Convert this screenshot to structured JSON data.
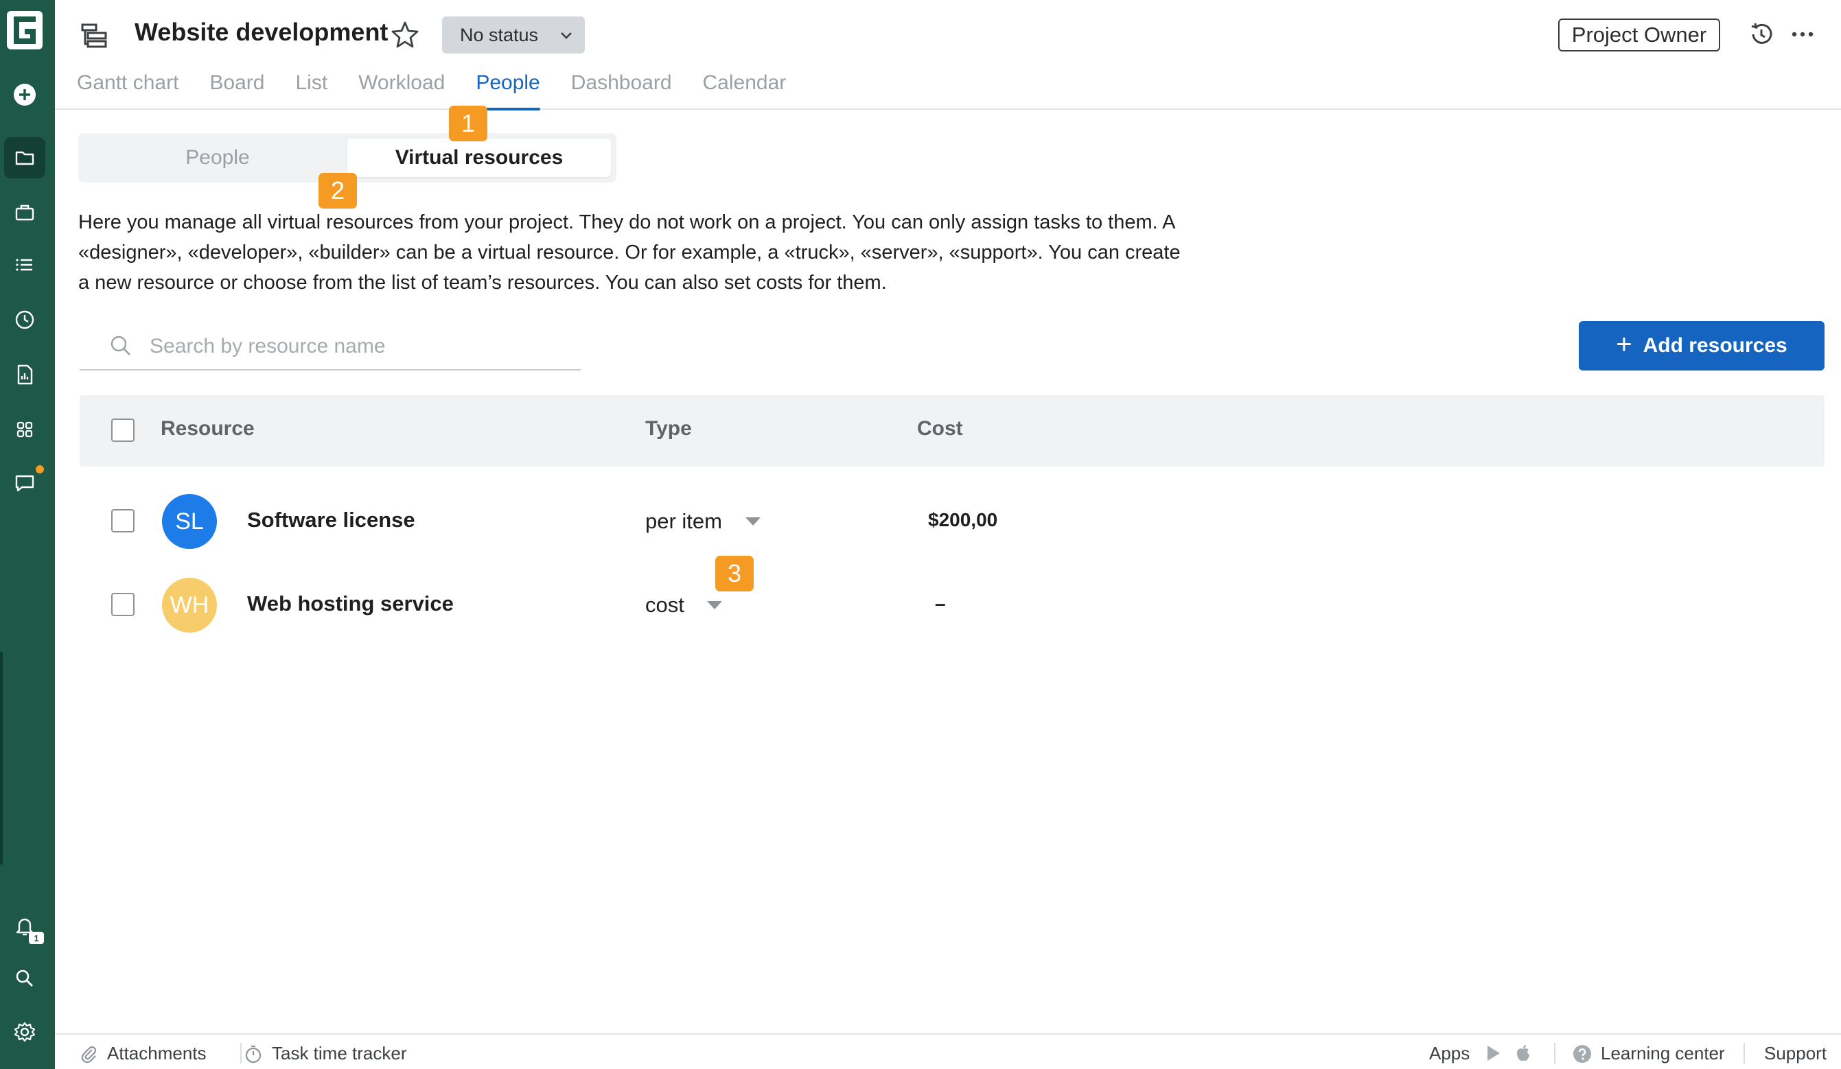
{
  "project": {
    "title": "Website development",
    "status": "No status",
    "role": "Project Owner"
  },
  "tabs": [
    "Gantt chart",
    "Board",
    "List",
    "Workload",
    "People",
    "Dashboard",
    "Calendar"
  ],
  "active_tab": "People",
  "segment": {
    "people_label": "People",
    "virtual_label": "Virtual resources",
    "selected": "Virtual resources"
  },
  "markers": [
    "1",
    "2",
    "3"
  ],
  "description": "Here you manage all virtual resources from your project. They do not work on a project. You can only assign tasks to them. A «designer», «developer», «builder» can be a virtual resource. Or for example, a «truck», «server», «support». You can create a new resource or choose from the list of team’s resources. You can also set costs for them.",
  "search": {
    "placeholder": "Search by resource name",
    "value": ""
  },
  "add_button": "Add resources",
  "table": {
    "headers": {
      "resource": "Resource",
      "type": "Type",
      "cost": "Cost"
    },
    "rows": [
      {
        "initials": "SL",
        "name": "Software license",
        "type": "per item",
        "cost": "$200,00",
        "avatar_color": "#1e7ce8"
      },
      {
        "initials": "WH",
        "name": "Web hosting service",
        "type": "cost",
        "cost": "–",
        "avatar_color": "#f7cd6b"
      }
    ]
  },
  "sidebar": {
    "icons": [
      "logo-icon",
      "add-icon",
      "folder-icon",
      "briefcase-icon",
      "list-icon",
      "clock-icon",
      "report-icon",
      "apps-icon",
      "chat-icon",
      "bell-icon",
      "search-icon",
      "settings-icon"
    ],
    "notification_count": "1"
  },
  "footer": {
    "attachments": "Attachments",
    "time_tracker": "Task time tracker",
    "apps": "Apps",
    "learning": "Learning center",
    "support": "Support"
  },
  "colors": {
    "sidebar": "#1e5847",
    "accent": "#1565c0",
    "marker": "#f59a23"
  }
}
